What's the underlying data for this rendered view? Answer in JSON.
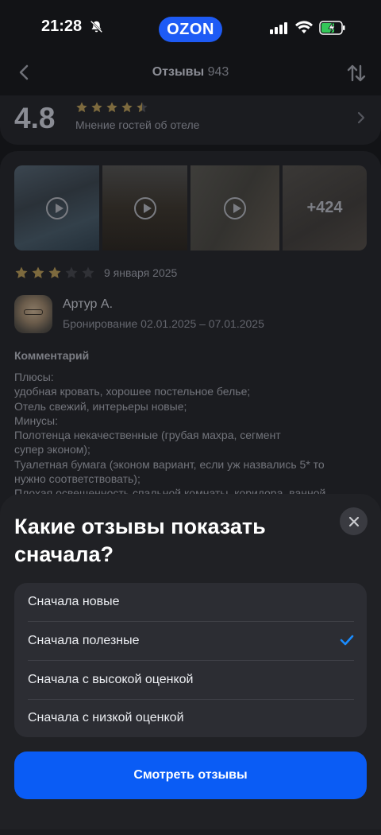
{
  "status_bar": {
    "time": "21:28",
    "logo_text": "OZON"
  },
  "header": {
    "title": "Отзывы",
    "count": "943"
  },
  "rating": {
    "score": "4.8",
    "stars_filled": 4.5,
    "label": "Мнение гостей об отеле"
  },
  "media": {
    "more_count": "+424",
    "video_count": 3
  },
  "review": {
    "stars": 3,
    "date": "9 января 2025",
    "author": "Артур А.",
    "booking": "Бронирование 02.01.2025 – 07.01.2025",
    "comment_heading": "Комментарий",
    "comment_text": "Плюсы:\nудобная кровать, хорошее постельное белье;\nОтель свежий, интерьеры новые;\nМинусы:\nПолотенца некачественные (грубая махра, сегмент\nсупер эконом);\nТуалетная бумага (эконом вариант, если уж назвались 5* то\nнужно соответствовать);\nПлохая освещенность спальной комнаты, коридора, ванной"
  },
  "sheet": {
    "title": "Какие отзывы показать сначала?",
    "options": [
      {
        "label": "Сначала новые",
        "selected": false
      },
      {
        "label": "Сначала полезные",
        "selected": true
      },
      {
        "label": "Сначала с высокой оценкой",
        "selected": false
      },
      {
        "label": "Сначала с низкой оценкой",
        "selected": false
      }
    ],
    "cta": "Смотреть отзывы"
  },
  "colors": {
    "accent": "#0a5cf5",
    "star": "#f5a623",
    "check": "#1a8cff"
  }
}
